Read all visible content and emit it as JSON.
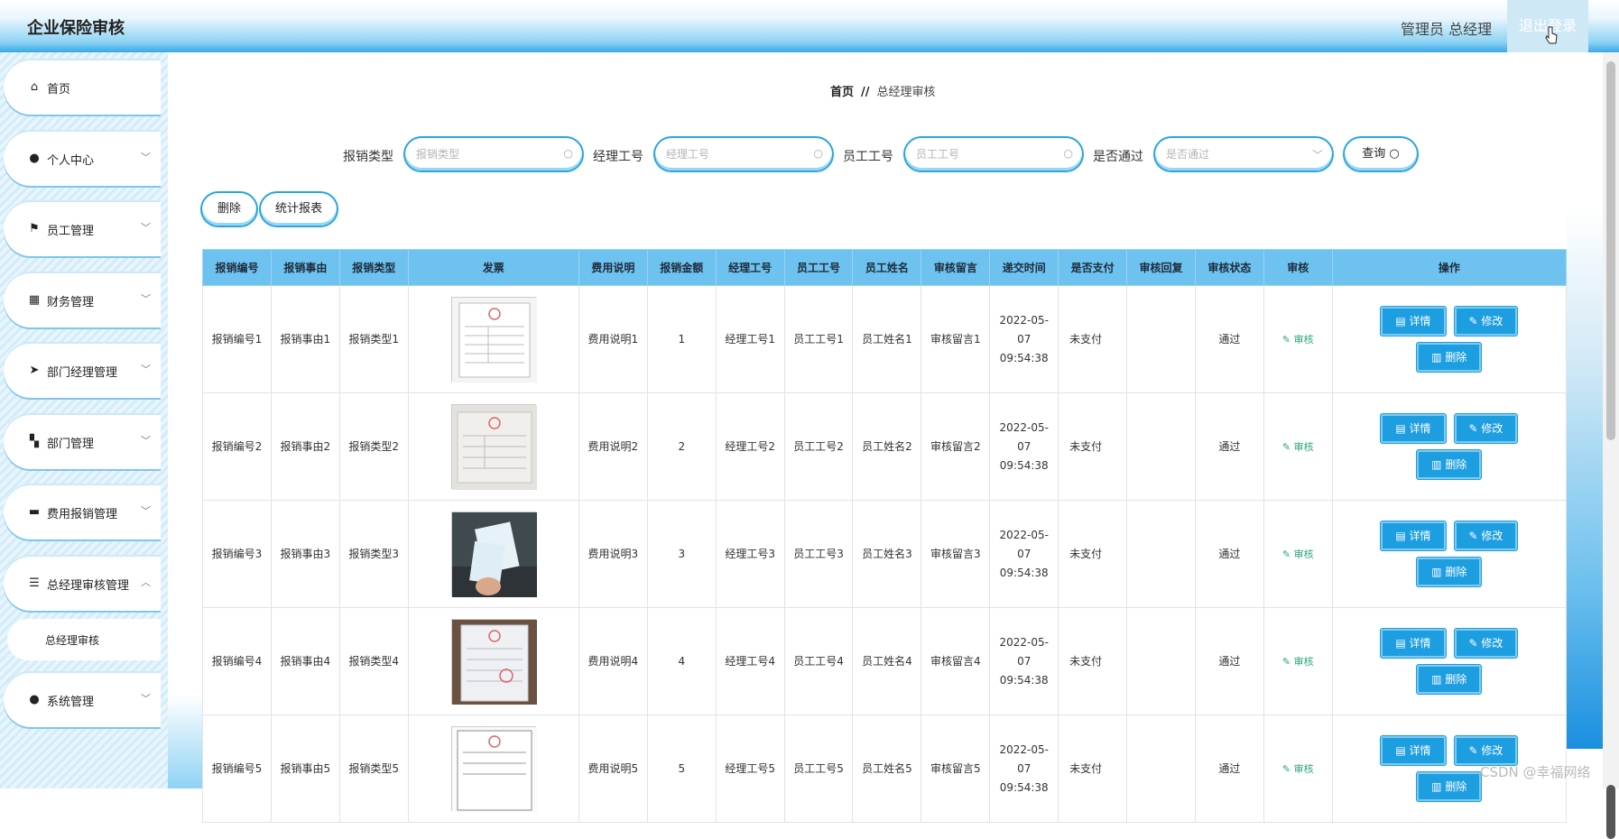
{
  "header": {
    "title": "企业保险审核",
    "user": "管理员 总经理",
    "logout": "退出登录"
  },
  "sidebar": {
    "items": [
      {
        "label": "首页",
        "icon": "home-icon",
        "glyph": "⌂",
        "chevron": ""
      },
      {
        "label": "个人中心",
        "icon": "user-icon",
        "glyph": "●",
        "chevron": "﹀"
      },
      {
        "label": "员工管理",
        "icon": "flag-icon",
        "glyph": "⚑",
        "chevron": "﹀"
      },
      {
        "label": "财务管理",
        "icon": "grid-icon",
        "glyph": "▦",
        "chevron": "﹀"
      },
      {
        "label": "部门经理管理",
        "icon": "send-icon",
        "glyph": "➤",
        "chevron": "﹀"
      },
      {
        "label": "部门管理",
        "icon": "apps-icon",
        "glyph": "▚",
        "chevron": "﹀"
      },
      {
        "label": "费用报销管理",
        "icon": "monitor-icon",
        "glyph": "▬",
        "chevron": "﹀"
      },
      {
        "label": "总经理审核管理",
        "icon": "list-icon",
        "glyph": "☰",
        "chevron": "︿"
      },
      {
        "label": "系统管理",
        "icon": "admin-icon",
        "glyph": "●",
        "chevron": "﹀"
      }
    ],
    "sub_item": "总经理审核"
  },
  "breadcrumb": {
    "home": "首页",
    "sep": "//",
    "current": "总经理审核"
  },
  "search": {
    "type_label": "报销类型",
    "type_placeholder": "报销类型",
    "manager_label": "经理工号",
    "manager_placeholder": "经理工号",
    "employee_label": "员工工号",
    "employee_placeholder": "员工工号",
    "pass_label": "是否通过",
    "pass_placeholder": "是否通过",
    "query": "查询"
  },
  "toolbar": {
    "delete": "删除",
    "report": "统计报表"
  },
  "table": {
    "columns": [
      "报销编号",
      "报销事由",
      "报销类型",
      "发票",
      "费用说明",
      "报销金额",
      "经理工号",
      "员工工号",
      "员工姓名",
      "审核留言",
      "递交时间",
      "是否支付",
      "审核回复",
      "审核状态",
      "审核",
      "操作"
    ],
    "rows": [
      {
        "no": "报销编号1",
        "reason": "报销事由1",
        "type": "报销类型1",
        "desc": "费用说明1",
        "amount": "1",
        "mgr": "经理工号1",
        "emp": "员工工号1",
        "name": "员工姓名1",
        "msg": "审核留言1",
        "time": "2022-05-07 09:54:38",
        "paid": "未支付",
        "reply": "",
        "status": "通过",
        "audit": "审核"
      },
      {
        "no": "报销编号2",
        "reason": "报销事由2",
        "type": "报销类型2",
        "desc": "费用说明2",
        "amount": "2",
        "mgr": "经理工号2",
        "emp": "员工工号2",
        "name": "员工姓名2",
        "msg": "审核留言2",
        "time": "2022-05-07 09:54:38",
        "paid": "未支付",
        "reply": "",
        "status": "通过",
        "audit": "审核"
      },
      {
        "no": "报销编号3",
        "reason": "报销事由3",
        "type": "报销类型3",
        "desc": "费用说明3",
        "amount": "3",
        "mgr": "经理工号3",
        "emp": "员工工号3",
        "name": "员工姓名3",
        "msg": "审核留言3",
        "time": "2022-05-07 09:54:38",
        "paid": "未支付",
        "reply": "",
        "status": "通过",
        "audit": "审核"
      },
      {
        "no": "报销编号4",
        "reason": "报销事由4",
        "type": "报销类型4",
        "desc": "费用说明4",
        "amount": "4",
        "mgr": "经理工号4",
        "emp": "员工工号4",
        "name": "员工姓名4",
        "msg": "审核留言4",
        "time": "2022-05-07 09:54:38",
        "paid": "未支付",
        "reply": "",
        "status": "通过",
        "audit": "审核"
      },
      {
        "no": "报销编号5",
        "reason": "报销事由5",
        "type": "报销类型5",
        "desc": "费用说明5",
        "amount": "5",
        "mgr": "经理工号5",
        "emp": "员工工号5",
        "name": "员工姓名5",
        "msg": "审核留言5",
        "time": "2022-05-07 09:54:38",
        "paid": "未支付",
        "reply": "",
        "status": "通过",
        "audit": "审核"
      }
    ],
    "actions": {
      "detail": "详情",
      "edit": "修改",
      "delete": "删除"
    }
  },
  "watermark": "CSDN @幸福网络",
  "colors": {
    "accent": "#1d9ee0",
    "header_row": "#6ec2ef",
    "audit_link": "#2aa57a"
  }
}
